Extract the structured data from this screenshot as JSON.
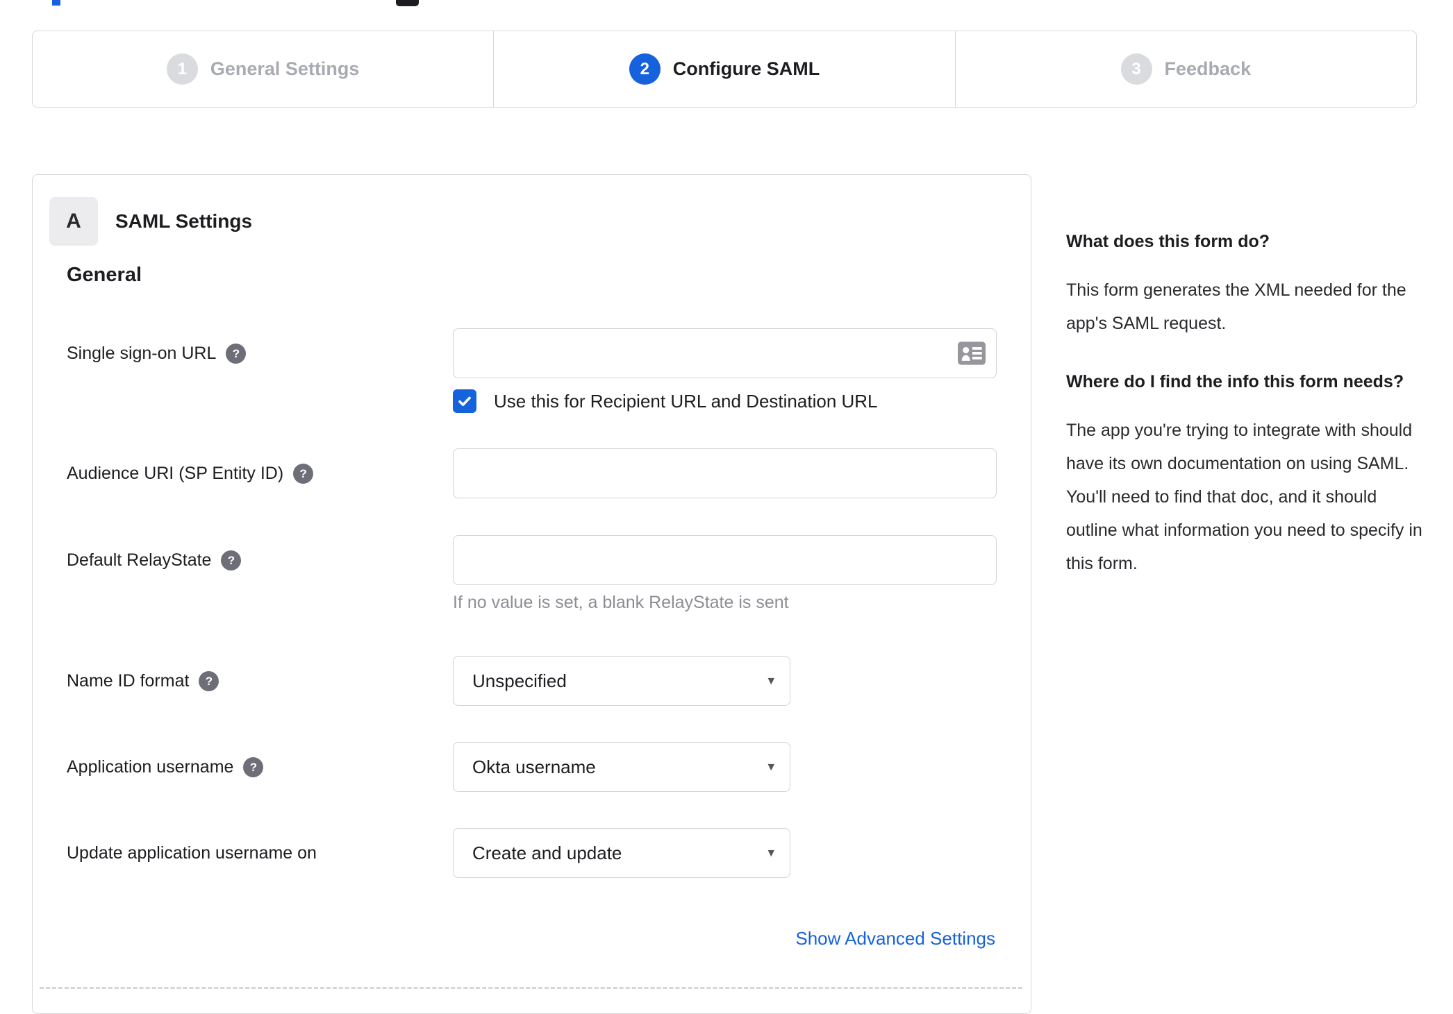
{
  "icons": {
    "help_glyph": "?",
    "caret_down": "▾"
  },
  "colors": {
    "accent_blue": "#1662dd",
    "text_dark": "#1d1d21",
    "inactive_grey": "#a8abb2",
    "border_grey": "#d8d8d8"
  },
  "stepper": {
    "steps": [
      {
        "number": "1",
        "label": "General Settings",
        "state": "inactive"
      },
      {
        "number": "2",
        "label": "Configure SAML",
        "state": "active"
      },
      {
        "number": "3",
        "label": "Feedback",
        "state": "inactive"
      }
    ]
  },
  "panel": {
    "badge": "A",
    "title": "SAML Settings",
    "section_title": "General",
    "sso": {
      "label": "Single sign-on URL",
      "value": "",
      "checkbox_label": "Use this for Recipient URL and Destination URL",
      "checked": true
    },
    "audience": {
      "label": "Audience URI (SP Entity ID)",
      "value": ""
    },
    "relay": {
      "label": "Default RelayState",
      "value": "",
      "hint": "If no value is set, a blank RelayState is sent"
    },
    "name_id": {
      "label": "Name ID format",
      "value": "Unspecified"
    },
    "app_username": {
      "label": "Application username",
      "value": "Okta username"
    },
    "update_username": {
      "label": "Update application username on",
      "value": "Create and update"
    },
    "advanced_link": "Show Advanced Settings"
  },
  "help_panel": {
    "q1_title": "What does this form do?",
    "q1_body": "This form generates the XML needed for the app's SAML request.",
    "q2_title": "Where do I find the info this form needs?",
    "q2_body": "The app you're trying to integrate with should have its own documentation on using SAML. You'll need to find that doc, and it should outline what information you need to specify in this form."
  }
}
